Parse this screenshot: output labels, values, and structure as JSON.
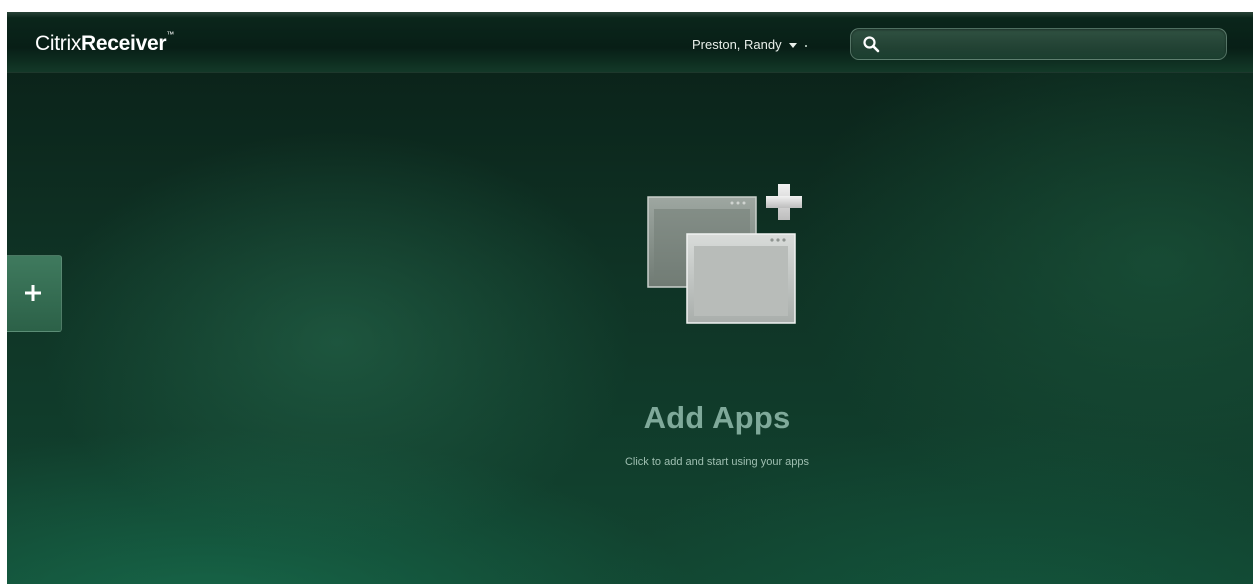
{
  "header": {
    "logo_light": "Citrix",
    "logo_bold": "Receiver",
    "logo_tm": "™",
    "user_name": "Preston, Randy",
    "search": {
      "value": "",
      "placeholder": ""
    }
  },
  "sidebar": {
    "add_tab_icon": "plus-icon"
  },
  "main": {
    "illustration_icon": "add-apps-windows-icon",
    "title": "Add Apps",
    "subtitle": "Click to add and start using your apps"
  },
  "colors": {
    "background": "#0f3325",
    "accent": "#3f7a5e",
    "title_text": "#7fa99a"
  }
}
